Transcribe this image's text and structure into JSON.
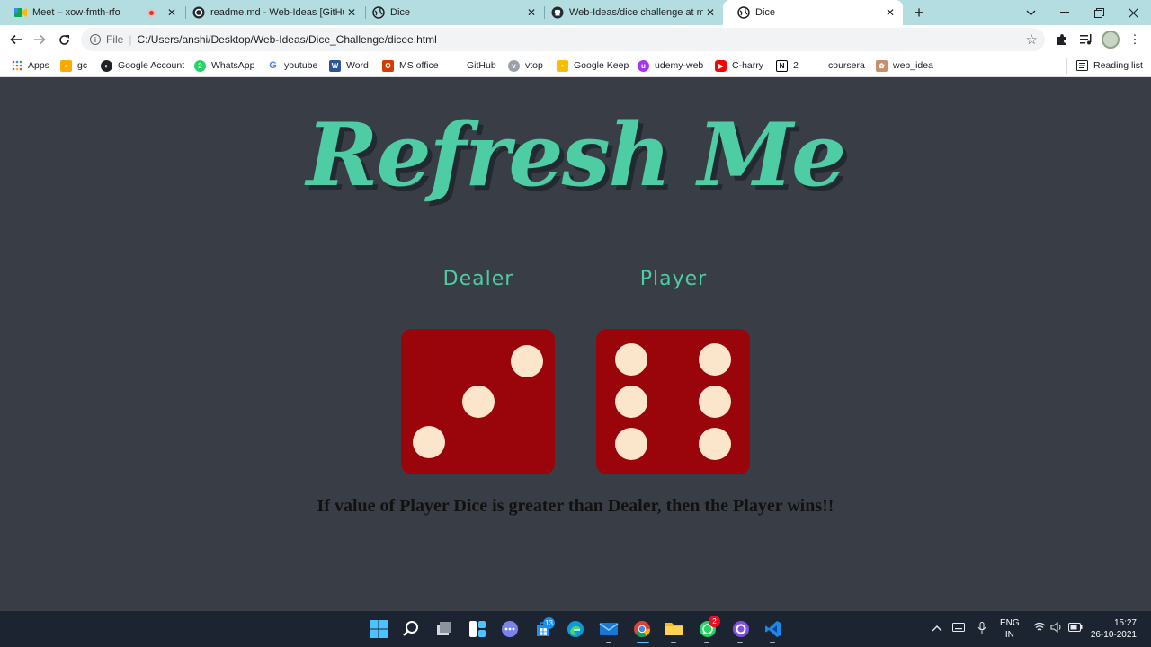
{
  "browser": {
    "tabs": [
      {
        "title": "Meet – xow-fmth-rfo",
        "icon": "google-meet-icon",
        "recording": true,
        "active": false
      },
      {
        "title": "readme.md - Web-Ideas [GitHub",
        "icon": "github-desktop-icon",
        "active": false
      },
      {
        "title": "Dice",
        "icon": "globe-icon",
        "active": false
      },
      {
        "title": "Web-Ideas/dice challenge at ma",
        "icon": "github-icon",
        "active": false
      },
      {
        "title": "Dice",
        "icon": "globe-icon",
        "active": true
      }
    ],
    "address": {
      "scheme_label": "File",
      "url": "C:/Users/anshi/Desktop/Web-Ideas/Dice_Challenge/dicee.html"
    },
    "bookmarks": [
      {
        "label": "Apps",
        "icon": "apps-grid-icon"
      },
      {
        "label": "gc",
        "icon": "google-classroom-icon"
      },
      {
        "label": "Google Account",
        "icon": "globe-icon"
      },
      {
        "label": "WhatsApp",
        "icon": "whatsapp-icon"
      },
      {
        "label": "youtube",
        "icon": "google-icon"
      },
      {
        "label": "Word",
        "icon": "word-icon"
      },
      {
        "label": "MS office",
        "icon": "office-icon"
      },
      {
        "label": "GitHub",
        "icon": "github-icon"
      },
      {
        "label": "vtop",
        "icon": "vtop-icon"
      },
      {
        "label": "Google Keep",
        "icon": "google-keep-icon"
      },
      {
        "label": "udemy-web",
        "icon": "udemy-icon"
      },
      {
        "label": "C-harry",
        "icon": "youtube-icon"
      },
      {
        "label": "2",
        "icon": "notion-icon"
      },
      {
        "label": "coursera",
        "icon": "coursera-icon"
      },
      {
        "label": "web_idea",
        "icon": "web-idea-icon"
      }
    ],
    "reading_list_label": "Reading list"
  },
  "page": {
    "heading": "Refresh Me",
    "dealer_label": "Dealer",
    "player_label": "Player",
    "dealer_value": 3,
    "player_value": 6,
    "rule_text": "If value of Player Dice is greater than Dealer, then the Player wins!!",
    "colors": {
      "background": "#393e46",
      "accent": "#4ecca3",
      "die": "#9a050b",
      "pip": "#fbe6cc"
    }
  },
  "taskbar": {
    "apps": [
      {
        "name": "start-button",
        "icon": "windows-start-icon"
      },
      {
        "name": "search",
        "icon": "search-icon"
      },
      {
        "name": "task-view",
        "icon": "task-view-icon"
      },
      {
        "name": "widgets",
        "icon": "widgets-icon"
      },
      {
        "name": "teams-chat",
        "icon": "teams-chat-icon"
      },
      {
        "name": "microsoft-store",
        "icon": "store-icon",
        "badge": "13"
      },
      {
        "name": "edge",
        "icon": "edge-icon"
      },
      {
        "name": "mail",
        "icon": "mail-icon"
      },
      {
        "name": "chrome",
        "icon": "chrome-icon"
      },
      {
        "name": "file-explorer",
        "icon": "folder-icon"
      },
      {
        "name": "whatsapp",
        "icon": "whatsapp-icon",
        "badge": "2"
      },
      {
        "name": "github-desktop",
        "icon": "github-desktop-icon"
      },
      {
        "name": "vs-code",
        "icon": "vscode-icon"
      }
    ],
    "language": {
      "line1": "ENG",
      "line2": "IN"
    },
    "time": "15:27",
    "date": "26-10-2021"
  }
}
